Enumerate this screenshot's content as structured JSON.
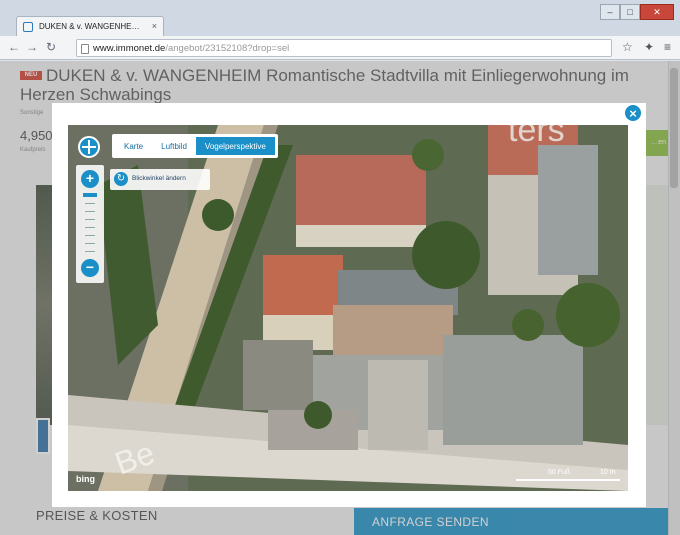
{
  "browser": {
    "tab_title": "DUKEN & v. WANGENHE…",
    "tab_close": "×",
    "url_host": "www.immonet.de",
    "url_path": "/angebot/23152108?drop=sel",
    "window_buttons": {
      "minimize": "–",
      "maximize": "□",
      "close": "✕"
    }
  },
  "listing": {
    "badge": "NEU",
    "title": "DUKEN & v. WANGENHEIM Romantische Stadtvilla mit Einliegerwohnung im Herzen Schwabings",
    "subtitle": "Sonstige",
    "price": "4,950",
    "price_label": "Kaufpreis",
    "side_button": "…en",
    "section_heading": "PREISE & KOSTEN",
    "cta_button": "ANFRAGE SENDEN"
  },
  "map_modal": {
    "close_label": "×",
    "modes": [
      {
        "label": "Karte",
        "active": false
      },
      {
        "label": "Luftbild",
        "active": false
      },
      {
        "label": "Vogelperspektive",
        "active": true
      }
    ],
    "angle_button": "Blickwinkel ändern",
    "zoom_in": "+",
    "zoom_out": "−",
    "attribution": "bing",
    "scale_labels": [
      "50 Fuß",
      "10 m"
    ],
    "accent_color": "#1a8fc8"
  }
}
